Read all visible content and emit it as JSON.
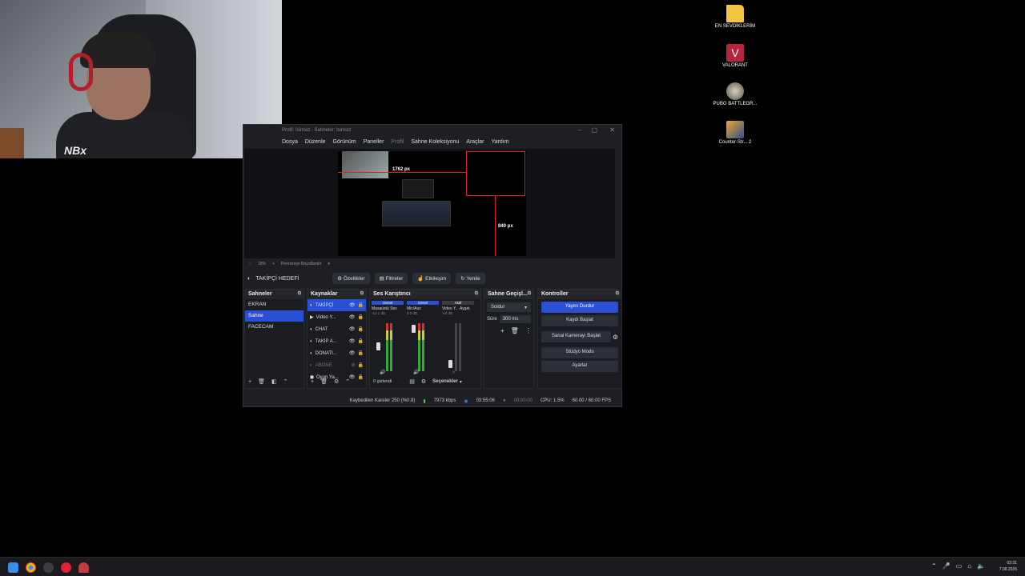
{
  "desktop": {
    "icons": [
      {
        "label": "EN SEVDİKLERİM",
        "icon": "folder-icon",
        "color": "#f2c545"
      },
      {
        "label": "VALORANT",
        "icon": "valorant-icon",
        "color": "#e84057"
      },
      {
        "label": "PUBG BATTLEGR...",
        "icon": "pubg-icon",
        "color": "#c9c2b2"
      },
      {
        "label": "Counter-Str... 2",
        "icon": "cs2-icon",
        "color": "#f0a830"
      }
    ]
  },
  "webcam": {
    "shirt_logo": "NBx"
  },
  "obs": {
    "title": "Profil: İsimsiz - Sahneler: İsimsiz",
    "menu": [
      "Dosya",
      "Düzenle",
      "Görünüm",
      "Paneller",
      "Profil",
      "Sahne Koleksiyonu",
      "Araçlar",
      "Yardım"
    ],
    "preview": {
      "width_label": "1762 px",
      "height_label": "840 px"
    },
    "zoom": {
      "minus": "−",
      "percent": "18%",
      "plus": "+",
      "fit": "Pencereye Boyutlandır"
    },
    "source_bar": {
      "name": "TAKİPÇİ HEDEFİ",
      "properties": "Özellikler",
      "filters": "Filtreler",
      "interact": "Etkileşim",
      "refresh": "Yenile"
    },
    "scenes": {
      "title": "Sahneler",
      "items": [
        "EKRAN",
        "Sahne",
        "FACECAM"
      ],
      "selected": 1
    },
    "sources": {
      "title": "Kaynaklar",
      "items": [
        "TAKİPÇİ",
        "Video Y...",
        "CHAT",
        "TAKİP A...",
        "DONATI...",
        "ABONE",
        "Oyun Ya..."
      ],
      "selected": 0
    },
    "mixer": {
      "title": "Ses Karıştırıcı",
      "channels": [
        {
          "tag": "Genel",
          "name": "Masaüstü Ses",
          "db": "-12.1 dB"
        },
        {
          "tag": "Genel",
          "name": "Mic/Aux",
          "db": "0.0 dB"
        },
        {
          "tag": "Aktif",
          "name": "Video Y... Aygıtı",
          "db": "-inf dB"
        }
      ],
      "hidden_label": "0 gizlendi",
      "options_label": "Seçenekler"
    },
    "transitions": {
      "title": "Sahne Geçişl...",
      "type": "Soldur",
      "duration_label": "Süre",
      "duration": "300 ms"
    },
    "controls": {
      "title": "Kontroller",
      "buttons": [
        "Yayını Durdur",
        "Kaydı Başlat",
        "Sanal Kamerayı Başlat",
        "Stüdyo Modu",
        "Ayarlar"
      ]
    },
    "status": {
      "dropped": "Kaybedilen Kareler 250 (%0.8)",
      "bitrate": "7973 kbps",
      "stream_time": "03:55:06",
      "rec_time": "00:00:00",
      "cpu": "CPU: 1.5%",
      "fps": "60.00 / 60.00 FPS"
    }
  },
  "taskbar": {
    "time": "02:31",
    "date": "7.08.2026"
  }
}
